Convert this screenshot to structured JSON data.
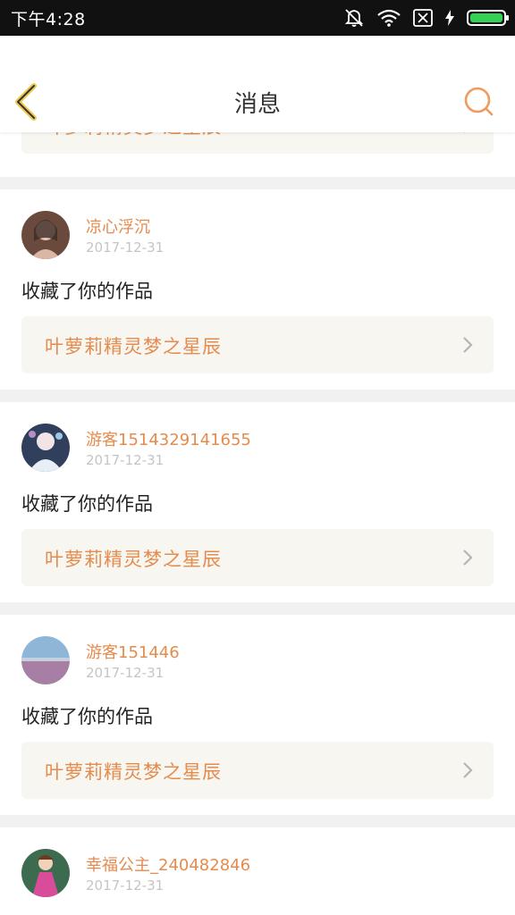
{
  "status_bar": {
    "time": "下午4:28",
    "battery_level": 1.0
  },
  "header": {
    "title": "消息"
  },
  "colors": {
    "accent": "#e58b4d",
    "battery": "#34d153"
  },
  "top_partial": {
    "link_label": "叶萝莉精灵梦之星辰"
  },
  "messages": [
    {
      "username": "凉心浮沉",
      "date": "2017-12-31",
      "action": "收藏了你的作品",
      "link_label": "叶萝莉精灵梦之星辰"
    },
    {
      "username": "游客1514329141655",
      "date": "2017-12-31",
      "action": "收藏了你的作品",
      "link_label": "叶萝莉精灵梦之星辰"
    },
    {
      "username": "游客151446",
      "date": "2017-12-31",
      "action": "收藏了你的作品",
      "link_label": "叶萝莉精灵梦之星辰"
    },
    {
      "username": "幸福公主_240482846",
      "date": "2017-12-31"
    }
  ],
  "icons": {
    "back": "chevron-left-icon",
    "search": "search-icon",
    "link_arrow": "chevron-right-icon"
  }
}
